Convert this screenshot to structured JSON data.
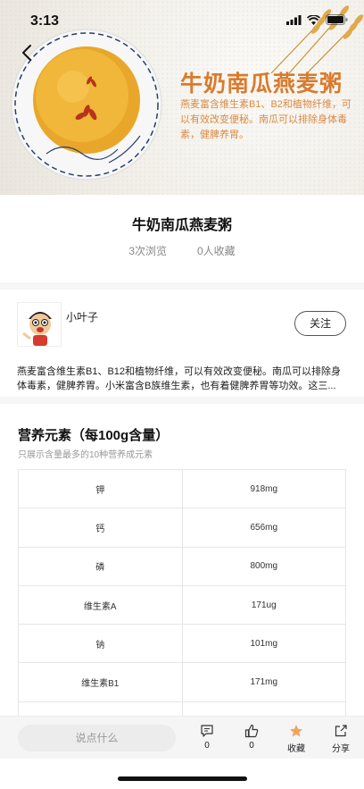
{
  "status_bar": {
    "time": "3:13"
  },
  "hero": {
    "title": "牛奶南瓜燕麦粥",
    "description": "燕麦富含维生素B1、B2和植物纤维，可以有效改变便秘。南瓜可以排除身体毒素，健脾养胃。"
  },
  "recipe": {
    "title": "牛奶南瓜燕麦粥",
    "views": "3次浏览",
    "favorites_count": "0人收藏"
  },
  "author": {
    "name": "小叶子",
    "follow_label": "关注",
    "description": "燕麦富含维生素B1、B12和植物纤维，可以有效改变便秘。南瓜可以排除身体毒素，健脾养胃。小米富含B族维生素，也有着健脾养胃等功效。这三..."
  },
  "nutrition": {
    "title": "营养元素（每100g含量）",
    "subtitle": "只展示含量最多的10种营养成元素",
    "rows": [
      {
        "name": "钾",
        "value": "918mg"
      },
      {
        "name": "钙",
        "value": "656mg"
      },
      {
        "name": "磷",
        "value": "800mg"
      },
      {
        "name": "维生素A",
        "value": "171ug"
      },
      {
        "name": "钠",
        "value": "101mg"
      },
      {
        "name": "维生素B1",
        "value": "171mg"
      }
    ]
  },
  "bottom_bar": {
    "comment_placeholder": "说点什么",
    "comments": "0",
    "likes": "0",
    "favorite_label": "收藏",
    "share_label": "分享"
  },
  "colors": {
    "accent": "#d97b2c",
    "favorite_star": "#f4a259"
  },
  "icons": [
    "back-arrow-icon",
    "signal-icon",
    "wifi-icon",
    "battery-icon",
    "comment-icon",
    "thumbs-up-icon",
    "star-icon",
    "share-icon"
  ]
}
